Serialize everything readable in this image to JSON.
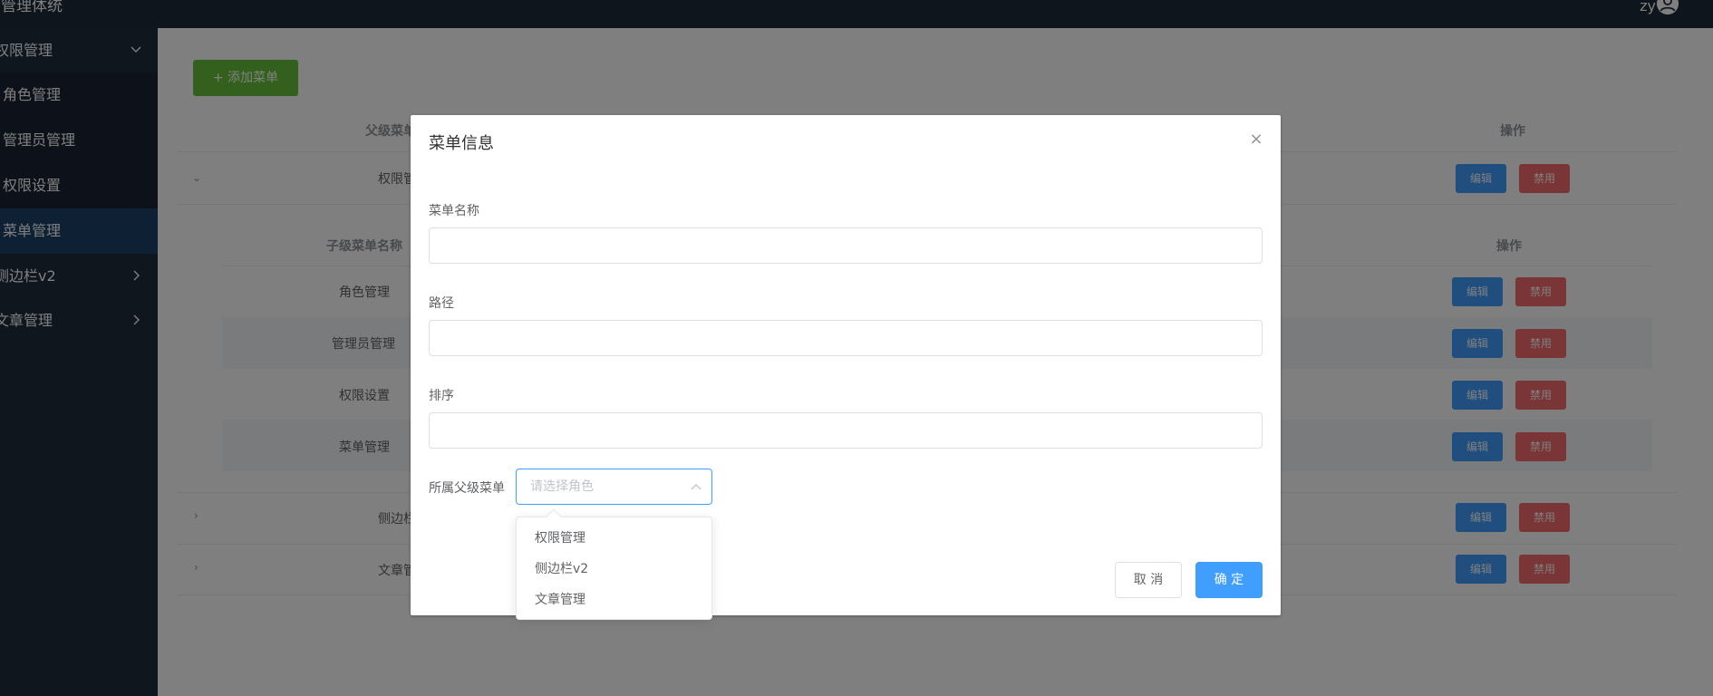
{
  "header": {
    "title": "台管理体统",
    "username": "zy"
  },
  "sidebar": {
    "group1": {
      "label": "权限管理"
    },
    "items": [
      {
        "label": "角色管理"
      },
      {
        "label": "管理员管理"
      },
      {
        "label": "权限设置"
      },
      {
        "label": "菜单管理"
      }
    ],
    "group2": {
      "label": "侧边栏v2"
    },
    "group3": {
      "label": "文章管理"
    }
  },
  "main": {
    "add_button": "+ 添加菜单",
    "col_parent": "父级菜单",
    "col_ops": "操作",
    "col_child": "子级菜单名称",
    "col_ops2": "操作",
    "parent_rows": [
      {
        "name": "权限管"
      },
      {
        "name": "侧边栏"
      },
      {
        "name": "文章管"
      }
    ],
    "child_rows": [
      {
        "name": "角色管理"
      },
      {
        "name": "管理员管理"
      },
      {
        "name": "权限设置"
      },
      {
        "name": "菜单管理"
      }
    ],
    "edit_label": "编辑",
    "disable_label": "禁用"
  },
  "dialog": {
    "title": "菜单信息",
    "field_name_label": "菜单名称",
    "field_name_value": "",
    "field_path_label": "路径",
    "field_path_value": "",
    "field_sort_label": "排序",
    "field_sort_value": "",
    "field_parent_label": "所属父级菜单",
    "parent_placeholder": "请选择角色",
    "cancel_label": "取 消",
    "ok_label": "确 定"
  },
  "dropdown": {
    "options": [
      "权限管理",
      "侧边栏v2",
      "文章管理"
    ]
  }
}
